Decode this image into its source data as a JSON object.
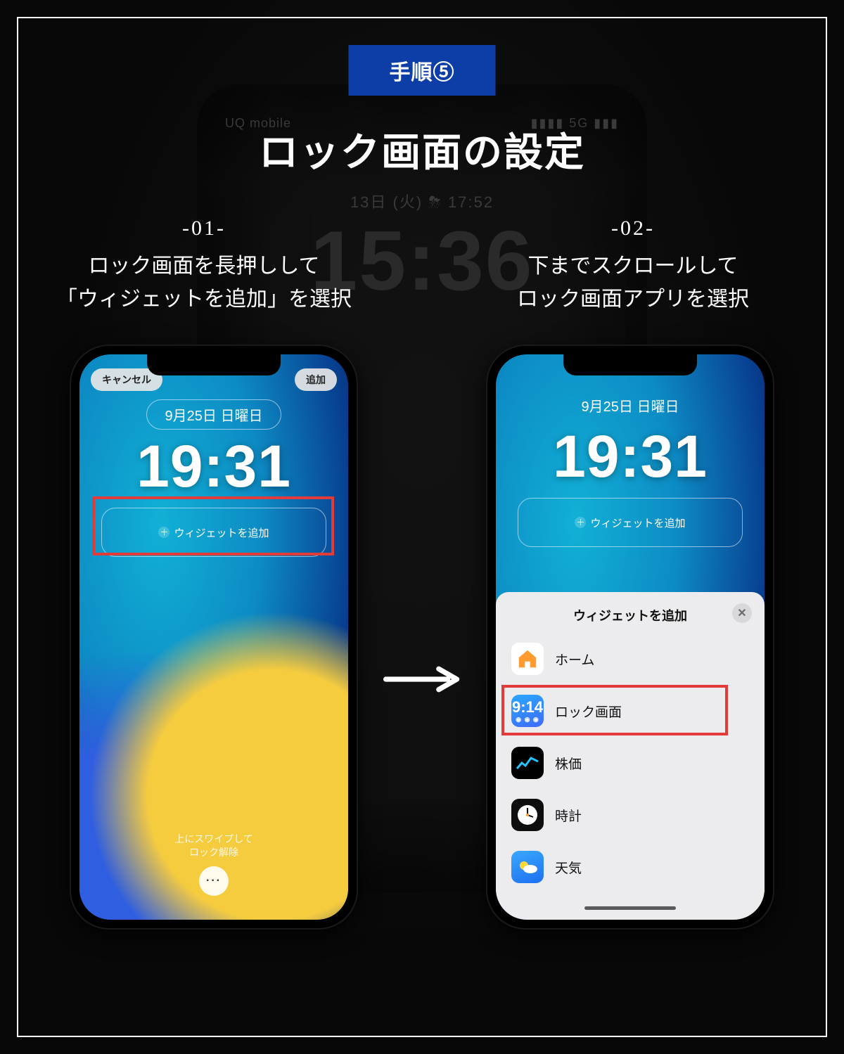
{
  "step_badge": "手順⑤",
  "title": "ロック画面の設定",
  "background": {
    "carrier": "UQ mobile",
    "signal": "5G",
    "date": "13日 (火)  ⛈ 17:52",
    "clock": "15:36"
  },
  "captions": [
    {
      "num": "-01-",
      "line1": "ロック画面を長押しして",
      "line2": "「ウィジェットを追加」を選択"
    },
    {
      "num": "-02-",
      "line1": "下までスクロールして",
      "line2": "ロック画面アプリを選択"
    }
  ],
  "phone_common": {
    "date": "9月25日 日曜日",
    "time": "19:31",
    "add_widget_label": "ウィジェットを追加",
    "swipe_hint_l1": "上にスワイプして",
    "swipe_hint_l2": "ロック解除"
  },
  "phone_left": {
    "cancel": "キャンセル",
    "add": "追加"
  },
  "sheet": {
    "title": "ウィジェットを追加",
    "items": [
      {
        "label": "ホーム",
        "icon": "home"
      },
      {
        "label": "ロック画面",
        "icon": "lock",
        "badge": "9:14"
      },
      {
        "label": "株価",
        "icon": "stocks"
      },
      {
        "label": "時計",
        "icon": "clock"
      },
      {
        "label": "天気",
        "icon": "weather"
      }
    ]
  }
}
